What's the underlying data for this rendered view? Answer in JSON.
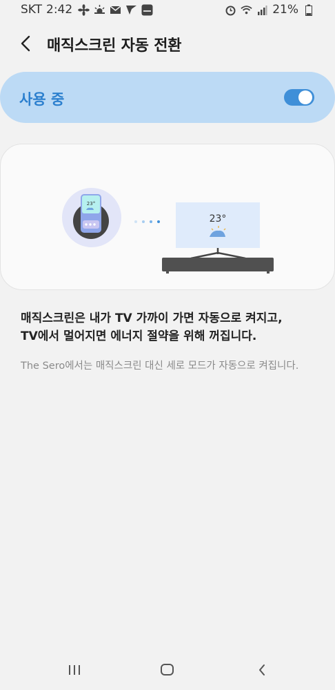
{
  "status_bar": {
    "carrier": "SKT",
    "time": "2:42",
    "battery": "21%",
    "icons_left": [
      "fan-icon",
      "weather-icon",
      "mail-icon",
      "app-icon",
      "global-app-icon"
    ],
    "icons_right": [
      "alarm-icon",
      "wifi-icon",
      "signal-icon",
      "battery-icon"
    ]
  },
  "header": {
    "title": "매직스크린 자동 전환"
  },
  "toggle": {
    "label": "사용 중",
    "state": true,
    "accent_color": "#3f8fd8"
  },
  "illustration": {
    "phone_temp": "23°",
    "tv_temp": "23°"
  },
  "description": {
    "line1": "매직스크린은 내가 TV 가까이 가면 자동으로 켜지고,",
    "line2": "TV에서 멀어지면 에너지 절약을 위해 꺼집니다."
  },
  "note": "The Sero에서는 매직스크린 대신 세로 모드가 자동으로 켜집니다.",
  "nav": {
    "icons": [
      "recent-apps-icon",
      "home-icon",
      "back-icon"
    ]
  }
}
